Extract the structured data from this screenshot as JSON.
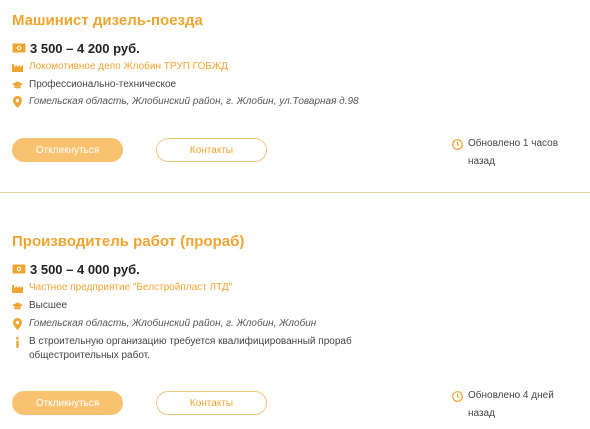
{
  "vacancies": [
    {
      "title": "Машинист дизель-поезда",
      "salary": "3 500 – 4 200 руб.",
      "employer": "Локомотивное депо Жлобин ТРУП ГОБЖД",
      "education": "Профессионально-техническое",
      "address": "Гомельская область, Жлобинский район, г. Жлобин, ул.Товарная д.98",
      "apply_label": "Откликнуться",
      "contacts_label": "Контакты",
      "updated": "Обновлено 1 часов назад"
    },
    {
      "title": "Производитель работ (прораб)",
      "salary": "3 500 – 4 000 руб.",
      "employer": "Частное предприятие \"Белстройпласт ЛТД\"",
      "education": "Высшее",
      "address": "Гомельская область, Жлобинский район, г. Жлобин, Жлобин",
      "description": "В строительную организацию требуется квалифицированный прораб общестроительных работ.",
      "apply_label": "Откликнуться",
      "contacts_label": "Контакты",
      "updated": "Обновлено 4 дней назад"
    }
  ],
  "colors": {
    "accent": "#f0a431",
    "button_fill": "#f8c271",
    "divider": "#e6d3a8"
  },
  "icons": [
    "money-icon",
    "factory-icon",
    "graduation-cap-icon",
    "location-pin-icon",
    "info-icon",
    "clock-icon"
  ]
}
